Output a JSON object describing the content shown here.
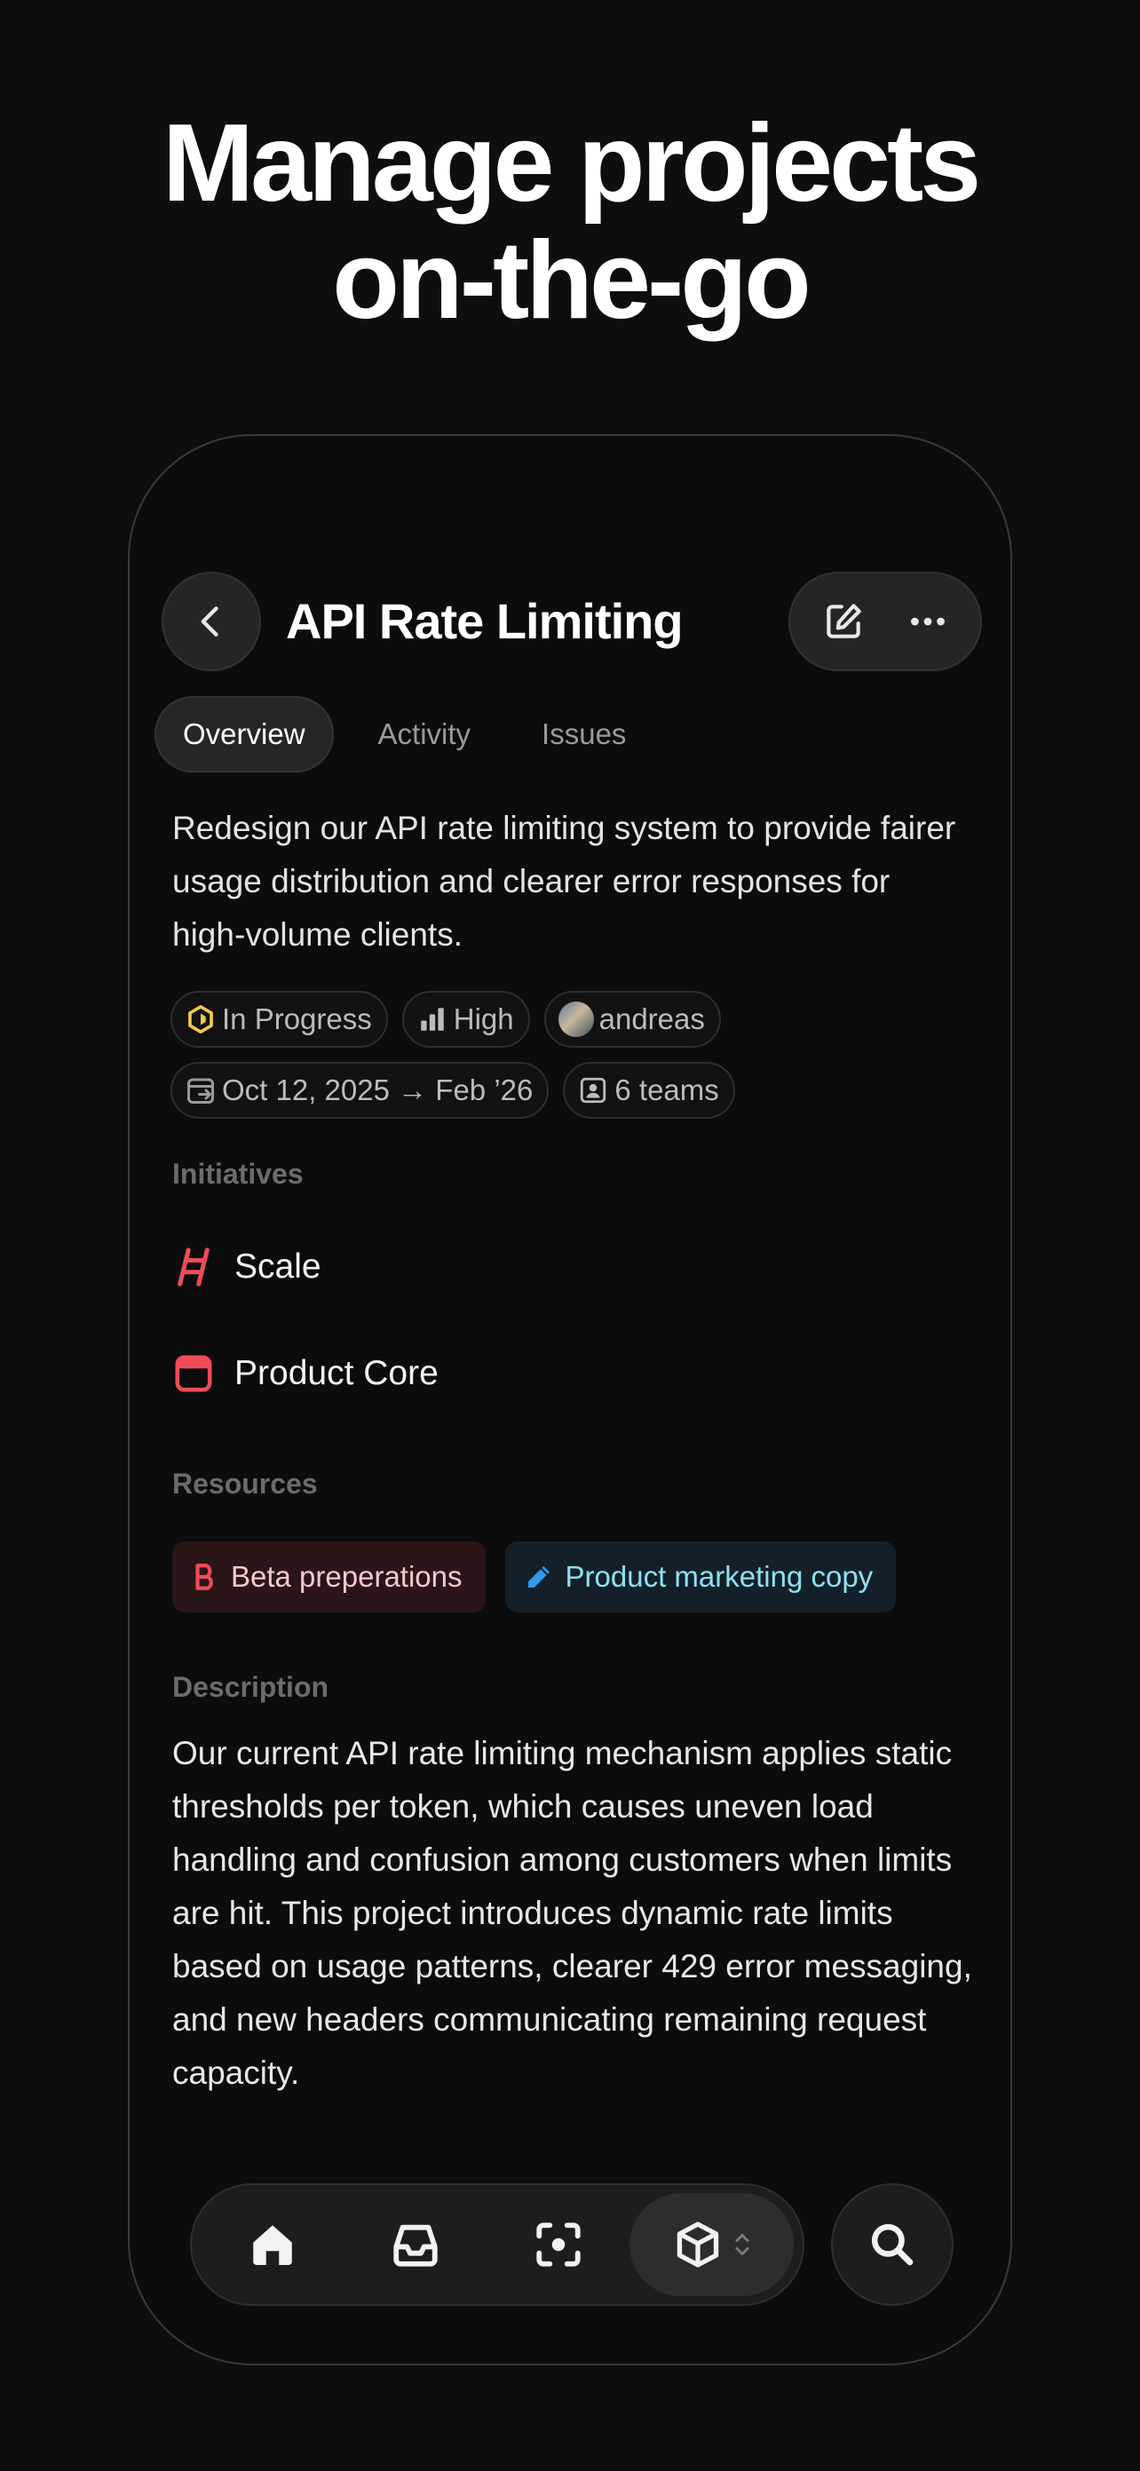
{
  "hero": {
    "line1": "Manage projects",
    "line2": "on-the-go"
  },
  "header": {
    "title": "API Rate Limiting",
    "back_icon": "chevron-left-icon",
    "edit_icon": "edit-icon",
    "more_icon": "more-icon"
  },
  "tabs": [
    {
      "label": "Overview",
      "active": true
    },
    {
      "label": "Activity",
      "active": false
    },
    {
      "label": "Issues",
      "active": false
    }
  ],
  "summary": "Redesign our API rate limiting system to provide fairer usage distribution and clearer error responses for high-volume clients.",
  "properties": {
    "status": "In Progress",
    "priority": "High",
    "lead": "andreas",
    "dates": "Oct 12, 2025 → Feb ’26",
    "teams": "6 teams"
  },
  "initiatives": {
    "label": "Initiatives",
    "items": [
      {
        "name": "Scale",
        "icon": "ladder-icon",
        "color": "#ef4b58"
      },
      {
        "name": "Product Core",
        "icon": "window-icon",
        "color": "#ef4b58"
      }
    ]
  },
  "resources": {
    "label": "Resources",
    "items": [
      {
        "name": "Beta preperations",
        "icon": "b-letter-icon",
        "color": "#ef4b58"
      },
      {
        "name": "Product marketing copy",
        "icon": "pencil-icon",
        "color": "#2f9cf0"
      }
    ]
  },
  "description": {
    "label": "Description",
    "text": "Our current API rate limiting mechanism applies static thresholds per token, which causes uneven load handling and confusion among customers when limits are hit. This project introduces dynamic rate limits based on usage patterns, clearer 429 error messaging, and new headers communicating remaining request capacity."
  },
  "colors": {
    "status_yellow": "#f2c94c",
    "accent_red": "#ef4b58",
    "accent_blue": "#2f9cf0"
  },
  "tabbar": {
    "items": [
      "home-icon",
      "inbox-icon",
      "scan-icon",
      "cube-icon"
    ],
    "search_icon": "search-icon"
  }
}
